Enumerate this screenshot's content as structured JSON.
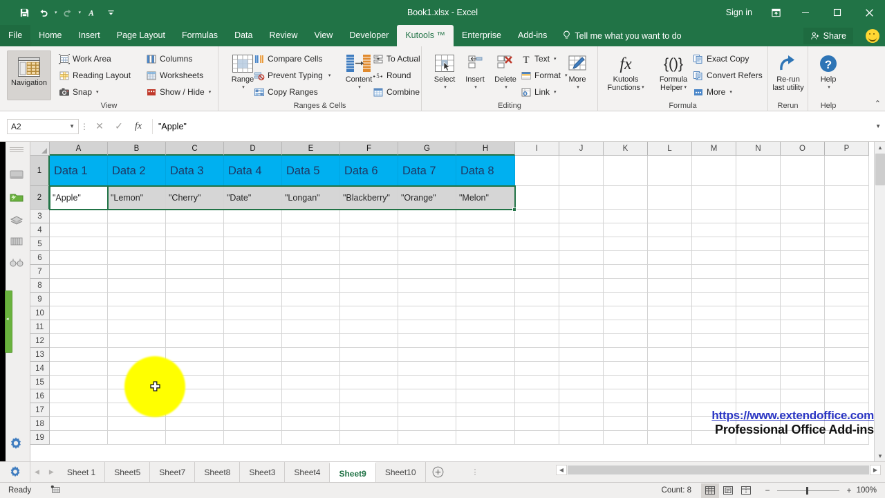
{
  "window": {
    "title": "Book1.xlsx - Excel",
    "sign_in": "Sign in",
    "minimize": "—",
    "maximize": "☐",
    "close": "✕"
  },
  "quick_access": [
    {
      "name": "save-icon",
      "label": "Save"
    },
    {
      "name": "undo-icon",
      "label": "Undo"
    },
    {
      "name": "redo-icon",
      "label": "Redo"
    },
    {
      "name": "font-icon",
      "label": "A"
    },
    {
      "name": "customize-qat-icon",
      "label": "Customize Quick Access Toolbar"
    }
  ],
  "ribbon_tabs": [
    {
      "label": "File",
      "active": false
    },
    {
      "label": "Home",
      "active": false
    },
    {
      "label": "Insert",
      "active": false
    },
    {
      "label": "Page Layout",
      "active": false
    },
    {
      "label": "Formulas",
      "active": false
    },
    {
      "label": "Data",
      "active": false
    },
    {
      "label": "Review",
      "active": false
    },
    {
      "label": "View",
      "active": false
    },
    {
      "label": "Developer",
      "active": false
    },
    {
      "label": "Kutools ™",
      "active": true
    },
    {
      "label": "Enterprise",
      "active": false
    },
    {
      "label": "Add-ins",
      "active": false
    }
  ],
  "tell_me": "Tell me what you want to do",
  "share": "Share",
  "ribbon_groups": {
    "view": {
      "label": "View",
      "navigation": "Navigation",
      "items": [
        "Work Area",
        "Reading Layout",
        "Snap",
        "Columns",
        "Worksheets",
        "Show / Hide"
      ]
    },
    "ranges_cells": {
      "label": "Ranges & Cells",
      "range": "Range",
      "content": "Content",
      "items": [
        "Compare Cells",
        "Prevent Typing",
        "Copy Ranges",
        "To Actual",
        "Round",
        "Combine"
      ]
    },
    "editing": {
      "label": "Editing",
      "big": [
        "Select",
        "Insert",
        "Delete",
        "More"
      ],
      "items": [
        "Text",
        "Format",
        "Link"
      ]
    },
    "formula": {
      "label": "Formula",
      "kutools_functions": "Kutools\nFunctions",
      "kutools_functions_l1": "Kutools",
      "kutools_functions_l2": "Functions",
      "formula_helper_l1": "Formula",
      "formula_helper_l2": "Helper",
      "items": [
        "Exact Copy",
        "Convert Refers",
        "More"
      ]
    },
    "rerun": {
      "label": "Rerun",
      "l1": "Re-run",
      "l2": "last utility"
    },
    "help": {
      "label": "Help",
      "btn": "Help"
    }
  },
  "formula_bar": {
    "name_box": "A2",
    "cancel": "✕",
    "enter": "✓",
    "fx": "fx",
    "value": "\"Apple\""
  },
  "nav_pane": {
    "items": [
      "workbook-icon",
      "worksheet-icon",
      "autotext-icon",
      "column-list-icon",
      "find-replace-icon"
    ],
    "settings": "settings-gear-icon"
  },
  "grid": {
    "columns": [
      "A",
      "B",
      "C",
      "D",
      "E",
      "F",
      "G",
      "H",
      "I",
      "J",
      "K",
      "L",
      "M",
      "N",
      "O",
      "P"
    ],
    "rows": [
      1,
      2,
      3,
      4,
      5,
      6,
      7,
      8,
      9,
      10,
      11,
      12,
      13,
      14,
      15,
      16,
      17,
      18,
      19
    ],
    "header_row": [
      "Data 1",
      "Data 2",
      "Data 3",
      "Data 4",
      "Data 5",
      "Data 6",
      "Data 7",
      "Data 8"
    ],
    "data_row": [
      "\"Apple\"",
      "\"Lemon\"",
      "\"Cherry\"",
      "\"Date\"",
      "\"Longan\"",
      "\"Blackberry\"",
      "\"Orange\"",
      "\"Melon\""
    ],
    "header_fill": "#00B0F0",
    "header_text_color": "#1F3864",
    "selection_color": "#217346",
    "selected_range": "A2:H2"
  },
  "watermark": {
    "url": "https://www.extendoffice.com",
    "tagline": "Professional Office Add-ins"
  },
  "sheet_tabs": {
    "tabs": [
      {
        "label": "Sheet 1",
        "active": false
      },
      {
        "label": "Sheet5",
        "active": false
      },
      {
        "label": "Sheet7",
        "active": false
      },
      {
        "label": "Sheet8",
        "active": false
      },
      {
        "label": "Sheet3",
        "active": false
      },
      {
        "label": "Sheet4",
        "active": false
      },
      {
        "label": "Sheet9",
        "active": true
      },
      {
        "label": "Sheet10",
        "active": false
      }
    ],
    "add": "+"
  },
  "status_bar": {
    "state": "Ready",
    "count": "Count: 8",
    "views": [
      "normal-view-icon",
      "page-layout-view-icon",
      "page-break-view-icon"
    ],
    "zoom_out": "−",
    "zoom_in": "+",
    "zoom": "100%"
  }
}
